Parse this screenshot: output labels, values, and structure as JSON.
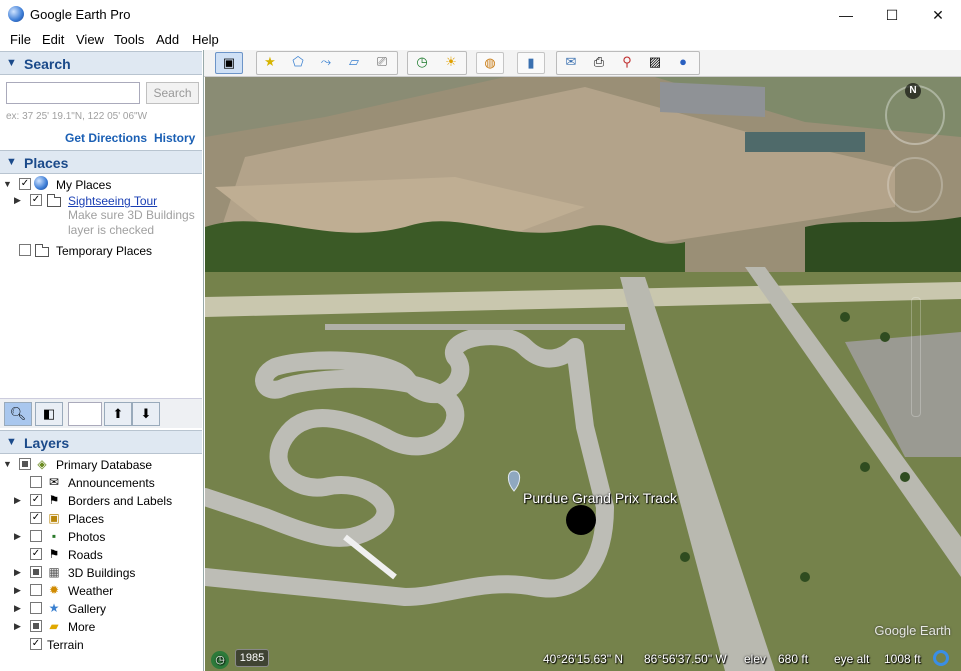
{
  "window": {
    "title": "Google Earth Pro",
    "minimize": "—",
    "maximize": "☐",
    "close": "✕"
  },
  "menu": {
    "items": [
      "File",
      "Edit",
      "View",
      "Tools",
      "Add",
      "Help"
    ]
  },
  "search": {
    "header": "Search",
    "placeholder": "",
    "button": "Search",
    "hint": "ex: 37 25' 19.1\"N, 122 05' 06\"W",
    "directions_link": "Get Directions",
    "history_link": "History"
  },
  "places": {
    "header": "Places",
    "my_places": "My Places",
    "sightseeing": "Sightseeing Tour",
    "note_line1": "Make sure 3D Buildings",
    "note_line2": "layer is checked",
    "temporary": "Temporary Places"
  },
  "layers": {
    "header": "Layers",
    "items": [
      {
        "label": "Primary Database",
        "icon": "database-icon"
      },
      {
        "label": "Announcements",
        "icon": "envelope-icon"
      },
      {
        "label": "Borders and Labels",
        "icon": "flag-icon"
      },
      {
        "label": "Places",
        "icon": "places-icon"
      },
      {
        "label": "Photos",
        "icon": "photo-icon"
      },
      {
        "label": "Roads",
        "icon": "road-icon"
      },
      {
        "label": "3D Buildings",
        "icon": "building-icon"
      },
      {
        "label": "Weather",
        "icon": "sun-icon"
      },
      {
        "label": "Gallery",
        "icon": "star-icon"
      },
      {
        "label": "More",
        "icon": "more-icon"
      },
      {
        "label": "Terrain",
        "icon": ""
      }
    ]
  },
  "map": {
    "placemark": "Purdue Grand Prix Track",
    "watermark": "Google Earth",
    "imagery_year": "1985",
    "lat": "40°26'15.63\" N",
    "lon": "86°56'37.50\" W",
    "elev_label": "elev",
    "elev": "680 ft",
    "eye_label": "eye alt",
    "eye_alt": "1008 ft",
    "north": "N"
  },
  "colors": {
    "section_header": "#dfe8f2",
    "accent": "#1b4a8a",
    "link": "#1a5fb4"
  }
}
